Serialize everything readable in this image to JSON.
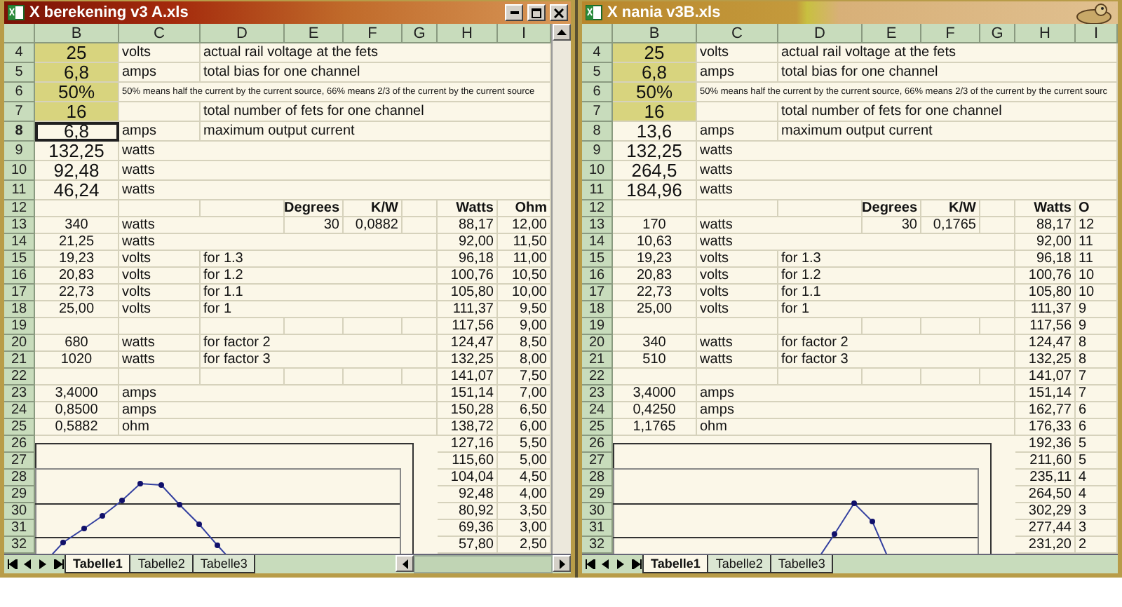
{
  "windows": [
    {
      "title": "X berekening v3 A.xls",
      "active": true,
      "columns": [
        "B",
        "C",
        "D",
        "E",
        "F",
        "G",
        "H",
        "I"
      ],
      "rows": [
        {
          "n": "4",
          "kind": "large",
          "highlighted": true,
          "b_selected": false,
          "B": "25",
          "C": "volts",
          "D": "actual rail voltage at the fets"
        },
        {
          "n": "5",
          "kind": "large",
          "highlighted": true,
          "b_selected": false,
          "B": "6,8",
          "C": "amps",
          "D": "total bias for one channel"
        },
        {
          "n": "6",
          "kind": "large",
          "highlighted": true,
          "b_selected": false,
          "B": "50%",
          "C": "50% means half the current by the current source, 66% means 2/3 of the current by the current source"
        },
        {
          "n": "7",
          "kind": "large",
          "highlighted": true,
          "b_selected": false,
          "B": "16",
          "D": "total number of fets for one channel"
        },
        {
          "n": "8",
          "kind": "large",
          "highlighted": false,
          "b_selected": true,
          "B": "6,8",
          "C": "amps",
          "D": "maximum output current"
        },
        {
          "n": "9",
          "kind": "large",
          "highlighted": false,
          "b_selected": false,
          "B": "132,25",
          "C": "watts"
        },
        {
          "n": "10",
          "kind": "large",
          "highlighted": false,
          "b_selected": false,
          "B": "92,48",
          "C": "watts"
        },
        {
          "n": "11",
          "kind": "large",
          "highlighted": false,
          "b_selected": false,
          "B": "46,24",
          "C": "watts"
        },
        {
          "n": "12",
          "kind": "header",
          "highlighted": false,
          "b_selected": false,
          "E": "Degrees",
          "F": "K/W",
          "H": "Watts",
          "I": "Ohm"
        },
        {
          "n": "13",
          "kind": "normal",
          "highlighted": false,
          "b_selected": false,
          "B": "340",
          "C": "watts",
          "E": "30",
          "F": "0,0882",
          "H": "88,17",
          "I": "12,00"
        },
        {
          "n": "14",
          "kind": "normal",
          "highlighted": false,
          "b_selected": false,
          "B": "21,25",
          "C": "watts",
          "H": "92,00",
          "I": "11,50"
        },
        {
          "n": "15",
          "kind": "normal",
          "highlighted": false,
          "b_selected": false,
          "B": "19,23",
          "C": "volts",
          "D": "for 1.3",
          "H": "96,18",
          "I": "11,00"
        },
        {
          "n": "16",
          "kind": "normal",
          "highlighted": false,
          "b_selected": false,
          "B": "20,83",
          "C": "volts",
          "D": "for 1.2",
          "H": "100,76",
          "I": "10,50"
        },
        {
          "n": "17",
          "kind": "normal",
          "highlighted": false,
          "b_selected": false,
          "B": "22,73",
          "C": "volts",
          "D": "for 1.1",
          "H": "105,80",
          "I": "10,00"
        },
        {
          "n": "18",
          "kind": "normal",
          "highlighted": false,
          "b_selected": false,
          "B": "25,00",
          "C": "volts",
          "D": "for 1",
          "H": "111,37",
          "I": "9,50"
        },
        {
          "n": "19",
          "kind": "normal",
          "highlighted": false,
          "b_selected": false,
          "H": "117,56",
          "I": "9,00"
        },
        {
          "n": "20",
          "kind": "normal",
          "highlighted": false,
          "b_selected": false,
          "B": "680",
          "C": "watts",
          "D": "for factor 2",
          "H": "124,47",
          "I": "8,50"
        },
        {
          "n": "21",
          "kind": "normal",
          "highlighted": false,
          "b_selected": false,
          "B": "1020",
          "C": "watts",
          "D": "for factor 3",
          "H": "132,25",
          "I": "8,00"
        },
        {
          "n": "22",
          "kind": "normal",
          "highlighted": false,
          "b_selected": false,
          "H": "141,07",
          "I": "7,50"
        },
        {
          "n": "23",
          "kind": "normal",
          "highlighted": false,
          "b_selected": false,
          "B": "3,4000",
          "C": "amps",
          "H": "151,14",
          "I": "7,00"
        },
        {
          "n": "24",
          "kind": "normal",
          "highlighted": false,
          "b_selected": false,
          "B": "0,8500",
          "C": "amps",
          "H": "150,28",
          "I": "6,50"
        },
        {
          "n": "25",
          "kind": "normal",
          "highlighted": false,
          "b_selected": false,
          "B": "0,5882",
          "C": "ohm",
          "H": "138,72",
          "I": "6,00"
        },
        {
          "n": "26",
          "kind": "normal",
          "highlighted": false,
          "b_selected": false,
          "H": "127,16",
          "I": "5,50"
        },
        {
          "n": "27",
          "kind": "normal",
          "highlighted": false,
          "b_selected": false,
          "H": "115,60",
          "I": "5,00"
        },
        {
          "n": "28",
          "kind": "normal",
          "highlighted": false,
          "b_selected": false,
          "H": "104,04",
          "I": "4,50"
        },
        {
          "n": "29",
          "kind": "normal",
          "highlighted": false,
          "b_selected": false,
          "H": "92,48",
          "I": "4,00"
        },
        {
          "n": "30",
          "kind": "normal",
          "highlighted": false,
          "b_selected": false,
          "H": "80,92",
          "I": "3,50"
        },
        {
          "n": "31",
          "kind": "normal",
          "highlighted": false,
          "b_selected": false,
          "H": "69,36",
          "I": "3,00"
        },
        {
          "n": "32",
          "kind": "normal",
          "highlighted": false,
          "b_selected": false,
          "H": "57,80",
          "I": "2,50"
        }
      ],
      "tabs": [
        {
          "label": "Tabelle1",
          "selected": true
        },
        {
          "label": "Tabelle2",
          "selected": false
        },
        {
          "label": "Tabelle3",
          "selected": false
        }
      ]
    },
    {
      "title": "X nania v3B.xls",
      "active": false,
      "columns": [
        "B",
        "C",
        "D",
        "E",
        "F",
        "G",
        "H",
        "I"
      ],
      "rows": [
        {
          "n": "4",
          "kind": "large",
          "highlighted": true,
          "b_selected": false,
          "B": "25",
          "C": "volts",
          "D": "actual rail voltage at the fets"
        },
        {
          "n": "5",
          "kind": "large",
          "highlighted": true,
          "b_selected": false,
          "B": "6,8",
          "C": "amps",
          "D": "total bias for one channel"
        },
        {
          "n": "6",
          "kind": "large",
          "highlighted": true,
          "b_selected": false,
          "B": "50%",
          "C": "50% means half the current by the current source, 66% means 2/3 of the current by the current sourc"
        },
        {
          "n": "7",
          "kind": "large",
          "highlighted": true,
          "b_selected": false,
          "B": "16",
          "D": "total number of fets for one channel"
        },
        {
          "n": "8",
          "kind": "large",
          "highlighted": false,
          "b_selected": false,
          "B": "13,6",
          "C": "amps",
          "D": "maximum output current"
        },
        {
          "n": "9",
          "kind": "large",
          "highlighted": false,
          "b_selected": false,
          "B": "132,25",
          "C": "watts"
        },
        {
          "n": "10",
          "kind": "large",
          "highlighted": false,
          "b_selected": false,
          "B": "264,5",
          "C": "watts"
        },
        {
          "n": "11",
          "kind": "large",
          "highlighted": false,
          "b_selected": false,
          "B": "184,96",
          "C": "watts"
        },
        {
          "n": "12",
          "kind": "header",
          "highlighted": false,
          "b_selected": false,
          "E": "Degrees",
          "F": "K/W",
          "H": "Watts",
          "I": "O"
        },
        {
          "n": "13",
          "kind": "normal",
          "highlighted": false,
          "b_selected": false,
          "B": "170",
          "C": "watts",
          "E": "30",
          "F": "0,1765",
          "H": "88,17",
          "I": "12"
        },
        {
          "n": "14",
          "kind": "normal",
          "highlighted": false,
          "b_selected": false,
          "B": "10,63",
          "C": "watts",
          "H": "92,00",
          "I": "11"
        },
        {
          "n": "15",
          "kind": "normal",
          "highlighted": false,
          "b_selected": false,
          "B": "19,23",
          "C": "volts",
          "D": "for 1.3",
          "H": "96,18",
          "I": "11"
        },
        {
          "n": "16",
          "kind": "normal",
          "highlighted": false,
          "b_selected": false,
          "B": "20,83",
          "C": "volts",
          "D": "for 1.2",
          "H": "100,76",
          "I": "10"
        },
        {
          "n": "17",
          "kind": "normal",
          "highlighted": false,
          "b_selected": false,
          "B": "22,73",
          "C": "volts",
          "D": "for 1.1",
          "H": "105,80",
          "I": "10"
        },
        {
          "n": "18",
          "kind": "normal",
          "highlighted": false,
          "b_selected": false,
          "B": "25,00",
          "C": "volts",
          "D": "for 1",
          "H": "111,37",
          "I": "9"
        },
        {
          "n": "19",
          "kind": "normal",
          "highlighted": false,
          "b_selected": false,
          "H": "117,56",
          "I": "9"
        },
        {
          "n": "20",
          "kind": "normal",
          "highlighted": false,
          "b_selected": false,
          "B": "340",
          "C": "watts",
          "D": "for factor 2",
          "H": "124,47",
          "I": "8"
        },
        {
          "n": "21",
          "kind": "normal",
          "highlighted": false,
          "b_selected": false,
          "B": "510",
          "C": "watts",
          "D": "for factor 3",
          "H": "132,25",
          "I": "8"
        },
        {
          "n": "22",
          "kind": "normal",
          "highlighted": false,
          "b_selected": false,
          "H": "141,07",
          "I": "7"
        },
        {
          "n": "23",
          "kind": "normal",
          "highlighted": false,
          "b_selected": false,
          "B": "3,4000",
          "C": "amps",
          "H": "151,14",
          "I": "7"
        },
        {
          "n": "24",
          "kind": "normal",
          "highlighted": false,
          "b_selected": false,
          "B": "0,4250",
          "C": "amps",
          "H": "162,77",
          "I": "6"
        },
        {
          "n": "25",
          "kind": "normal",
          "highlighted": false,
          "b_selected": false,
          "B": "1,1765",
          "C": "ohm",
          "H": "176,33",
          "I": "6"
        },
        {
          "n": "26",
          "kind": "normal",
          "highlighted": false,
          "b_selected": false,
          "H": "192,36",
          "I": "5"
        },
        {
          "n": "27",
          "kind": "normal",
          "highlighted": false,
          "b_selected": false,
          "H": "211,60",
          "I": "5"
        },
        {
          "n": "28",
          "kind": "normal",
          "highlighted": false,
          "b_selected": false,
          "H": "235,11",
          "I": "4"
        },
        {
          "n": "29",
          "kind": "normal",
          "highlighted": false,
          "b_selected": false,
          "H": "264,50",
          "I": "4"
        },
        {
          "n": "30",
          "kind": "normal",
          "highlighted": false,
          "b_selected": false,
          "H": "302,29",
          "I": "3"
        },
        {
          "n": "31",
          "kind": "normal",
          "highlighted": false,
          "b_selected": false,
          "H": "277,44",
          "I": "3"
        },
        {
          "n": "32",
          "kind": "normal",
          "highlighted": false,
          "b_selected": false,
          "H": "231,20",
          "I": "2"
        }
      ],
      "tabs": [
        {
          "label": "Tabelle1",
          "selected": true
        },
        {
          "label": "Tabelle2",
          "selected": false
        },
        {
          "label": "Tabelle3",
          "selected": false
        }
      ]
    }
  ]
}
